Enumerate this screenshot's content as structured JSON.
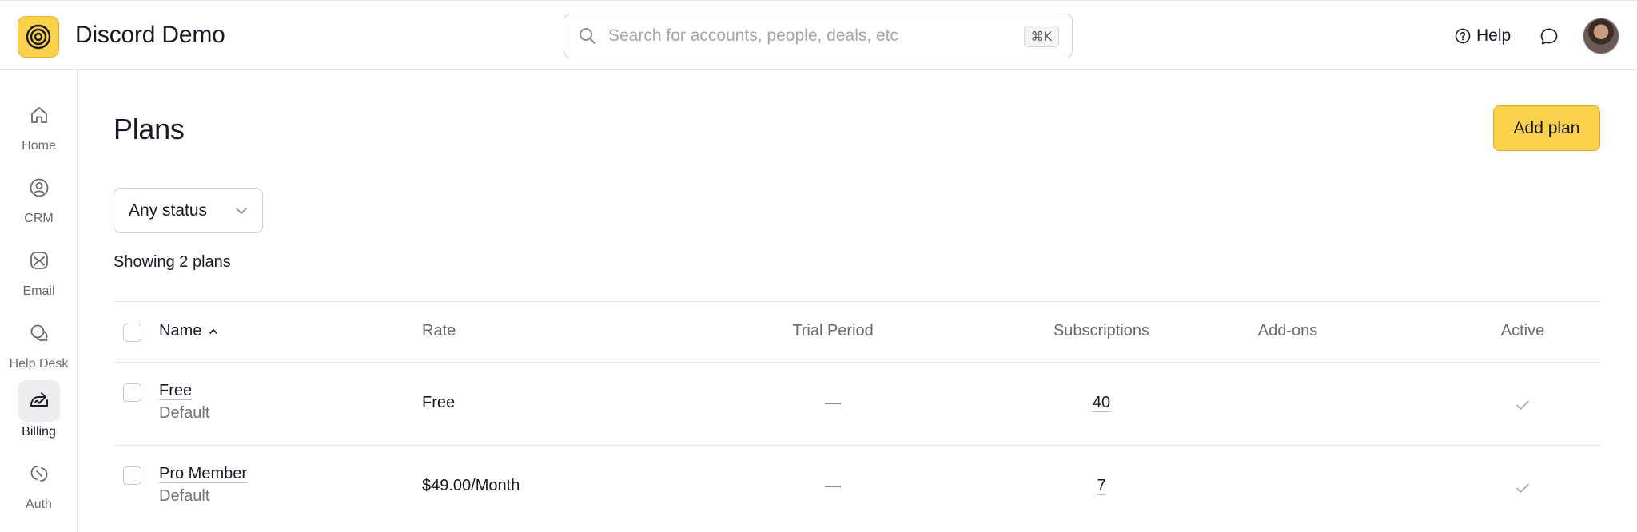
{
  "app": {
    "title": "Discord Demo"
  },
  "search": {
    "placeholder": "Search for accounts, people, deals, etc",
    "shortcut": "⌘K"
  },
  "header": {
    "help_label": "Help"
  },
  "sidebar": {
    "items": [
      {
        "label": "Home",
        "icon": "home-icon"
      },
      {
        "label": "CRM",
        "icon": "person-circle-icon"
      },
      {
        "label": "Email",
        "icon": "mail-icon"
      },
      {
        "label": "Help Desk",
        "icon": "chat-bubbles-icon"
      },
      {
        "label": "Billing",
        "icon": "billing-icon",
        "active": true
      },
      {
        "label": "Auth",
        "icon": "auth-icon"
      }
    ]
  },
  "page": {
    "title": "Plans",
    "add_button": "Add plan",
    "status_filter": "Any status",
    "count_text": "Showing 2 plans"
  },
  "table": {
    "columns": [
      "Name",
      "Rate",
      "Trial Period",
      "Subscriptions",
      "Add-ons",
      "Active"
    ],
    "sort_indicator": "^",
    "rows": [
      {
        "name": "Free",
        "sub": "Default",
        "rate": "Free",
        "trial": "—",
        "subscriptions": "40",
        "addons": "",
        "active": true
      },
      {
        "name": "Pro Member",
        "sub": "Default",
        "rate": "$49.00/Month",
        "trial": "—",
        "subscriptions": "7",
        "addons": "",
        "active": true
      }
    ]
  },
  "colors": {
    "accent": "#f9d14d",
    "border": "#e3e3e6",
    "muted_text": "#6b6872"
  }
}
